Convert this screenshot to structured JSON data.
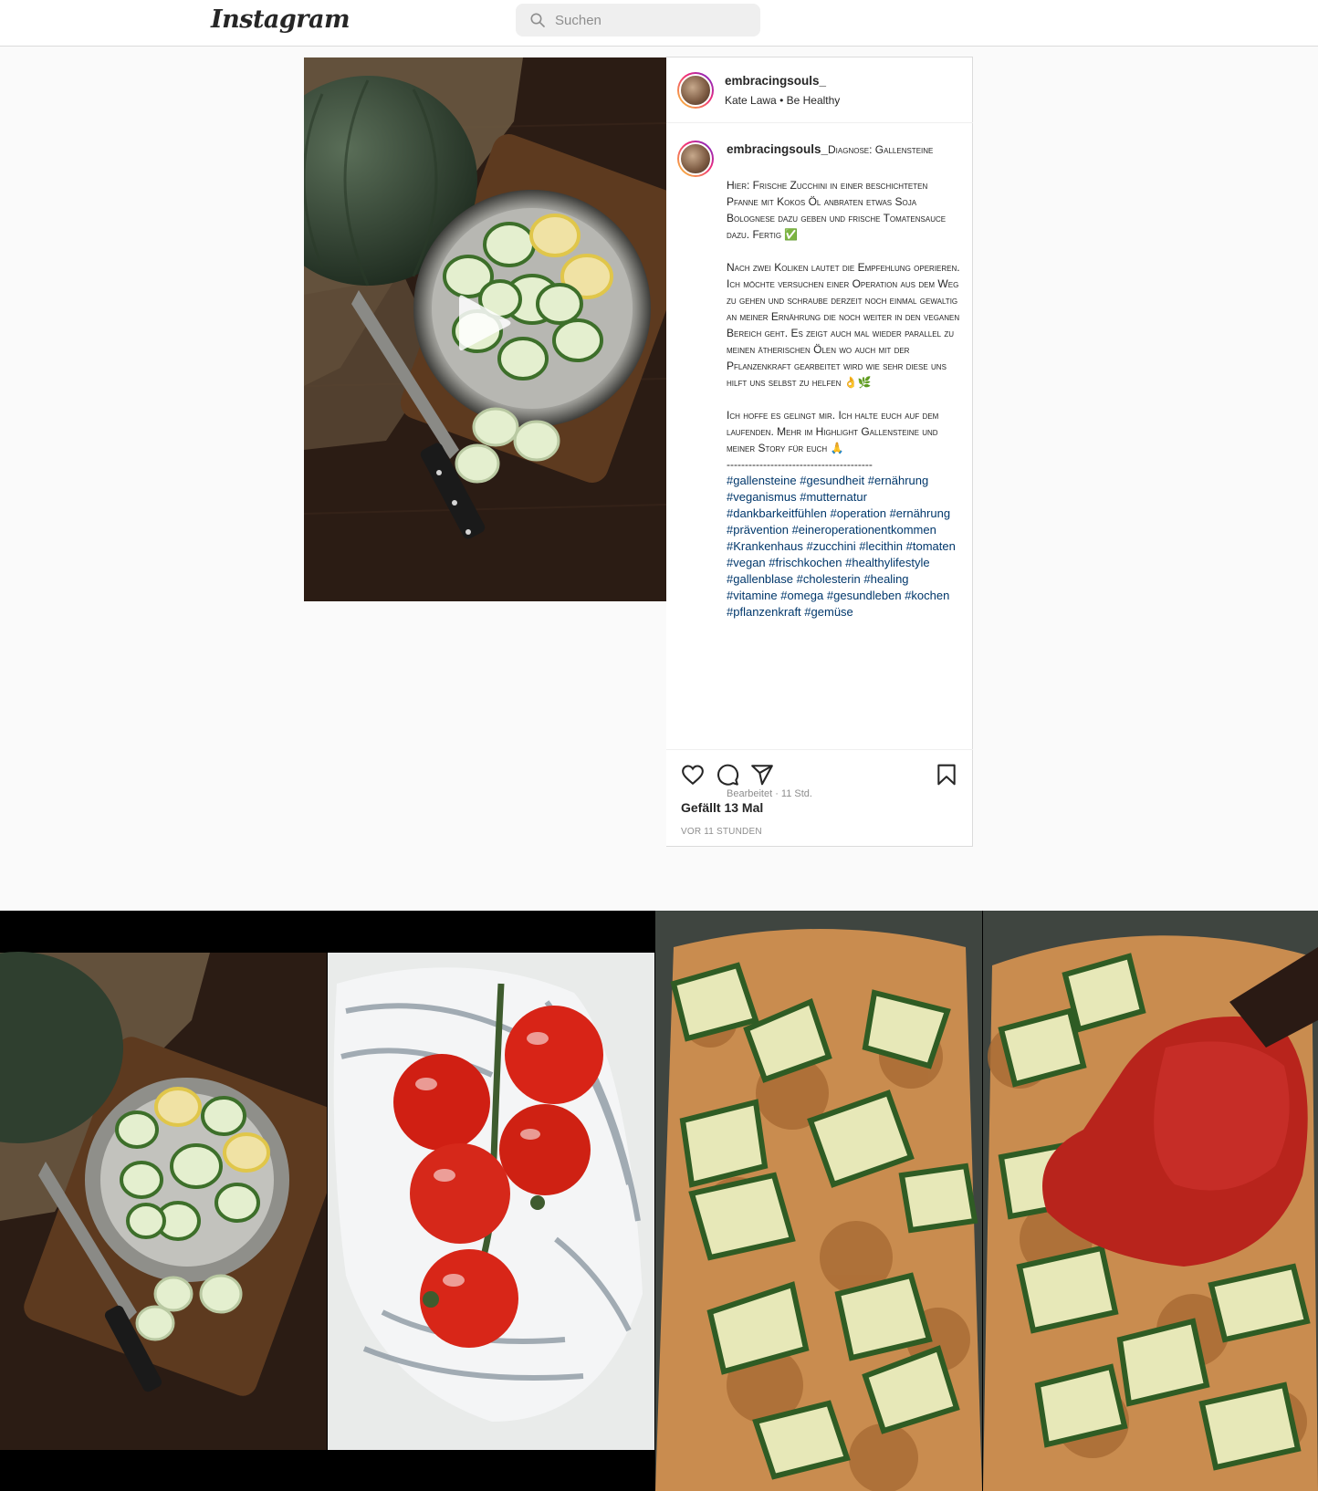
{
  "header": {
    "logo_text": "Instagram",
    "search_placeholder": "Suchen"
  },
  "post": {
    "author": {
      "username": "embracingsouls_",
      "display_name": "Kate Lawa",
      "separator": "•",
      "subtitle": "Be Healthy"
    },
    "caption": {
      "username": "embracingsouls_",
      "title": "Diagnose: Gallensteine",
      "paragraphs": [
        "Hier: Frische Zucchini in einer beschichteten Pfanne mit Kokos Öl anbraten etwas Soja Bolognese dazu geben und frische Tomatensauce dazu. Fertig ✅",
        "Nach zwei Koliken lautet die Empfehlung operieren. Ich möchte versuchen einer Operation aus dem Weg zu gehen und schraube derzeit noch einmal gewaltig an meiner Ernährung die noch weiter in den veganen Bereich geht. Es zeigt auch mal wieder parallel zu meinen ätherischen Ölen wo auch mit der Pflanzenkraft gearbeitet wird wie sehr diese uns hilft uns selbst zu helfen 👌🌿",
        "Ich hoffe es gelingt mir. Ich halte euch auf dem laufenden. Mehr im Highlight Gallensteine und meiner Story für euch 🙏"
      ],
      "divider": "----------------------------------------",
      "hashtags": [
        "#gallensteine",
        "#gesundheit",
        "#ernährung",
        "#veganismus",
        "#mutternatur",
        "#dankbarkeitfühlen",
        "#operation",
        "#ernährung",
        "#prävention",
        "#eineroperationentkommen",
        "#Krankenhaus",
        "#zucchini",
        "#lecithin",
        "#tomaten",
        "#vegan",
        "#frischkochen",
        "#healthylifestyle",
        "#gallenblase",
        "#cholesterin",
        "#healing",
        "#vitamine",
        "#omega",
        "#gesundleben",
        "#kochen",
        "#pflanzenkraft",
        "#gemüse"
      ],
      "edited_label": "Bearbeitet · 11 Std."
    },
    "likes_text": "Gefällt 13 Mal",
    "time_ago": "VOR 11 STUNDEN",
    "icons": [
      "heart-icon",
      "comment-icon",
      "share-icon",
      "bookmark-icon",
      "play-icon"
    ]
  },
  "colors": {
    "link": "#00376b",
    "border": "#dbdbdb",
    "muted": "#8e8e8e",
    "background": "#fafafa"
  }
}
